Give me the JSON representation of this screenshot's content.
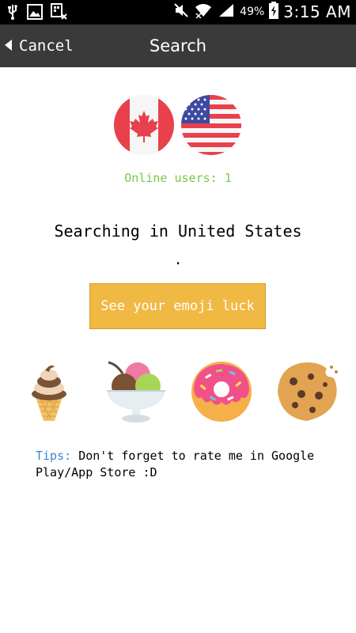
{
  "status_bar": {
    "battery_percent": "49%",
    "time": "3:15 AM"
  },
  "action_bar": {
    "cancel_label": "Cancel",
    "title": "Search"
  },
  "online": {
    "label": "Online users:",
    "count": "1"
  },
  "search": {
    "status": "Searching in United States",
    "progress_dots": "."
  },
  "luck_button": {
    "label": "See your emoji luck"
  },
  "emojis": [
    "ice-cream-cone",
    "ice-cream-bowl",
    "donut",
    "cookie"
  ],
  "tips": {
    "label": "Tips:",
    "text": "Don't forget to rate me in Google Play/App Store :D"
  },
  "colors": {
    "online_green": "#78c84a",
    "button_orange": "#f0b944",
    "tips_blue": "#3c84d8",
    "actionbar": "#3a3a3a"
  }
}
